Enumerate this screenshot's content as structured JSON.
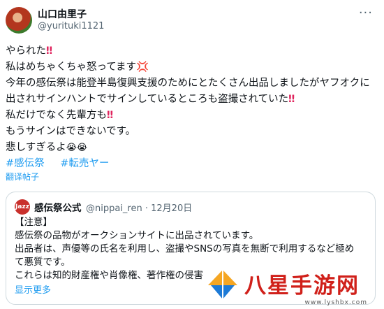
{
  "author": {
    "name": "山口由里子",
    "handle": "@yurituki1121"
  },
  "tweet": {
    "lines": [
      "やられた",
      "私はめちゃくちゃ怒ってます",
      "今年の感伝祭は能登半島復興支援のためにとたくさん出品しましたがヤフオクに出されサインハントでサインしているところも盗撮されていた",
      "私だけでなく先輩方も",
      "もうサインはできないです。",
      "悲しすぎるよ"
    ],
    "emoji_marks": {
      "exclaim": "‼",
      "anger": "💢",
      "cry": "😭😭"
    },
    "hashtags": [
      "#感伝祭",
      "#転売ヤー"
    ]
  },
  "translate_label": "翻译帖子",
  "quote": {
    "logo_text": "Jazz",
    "name": "感伝祭公式",
    "handle_date": "@nippai_ren · 12月20日",
    "lines": [
      "【注意】",
      "感伝祭の品物がオークションサイトに出品されています。",
      "出品者は、声優等の氏名を利用し、盗撮やSNSの写真を無断で利用するなど極め",
      "て悪質です。",
      "これらは知的財産権や肖像権、著作権の侵害"
    ],
    "show_more": "显示更多"
  },
  "watermark": {
    "text": "八星手游网",
    "url": "www.lyshbx.com"
  }
}
